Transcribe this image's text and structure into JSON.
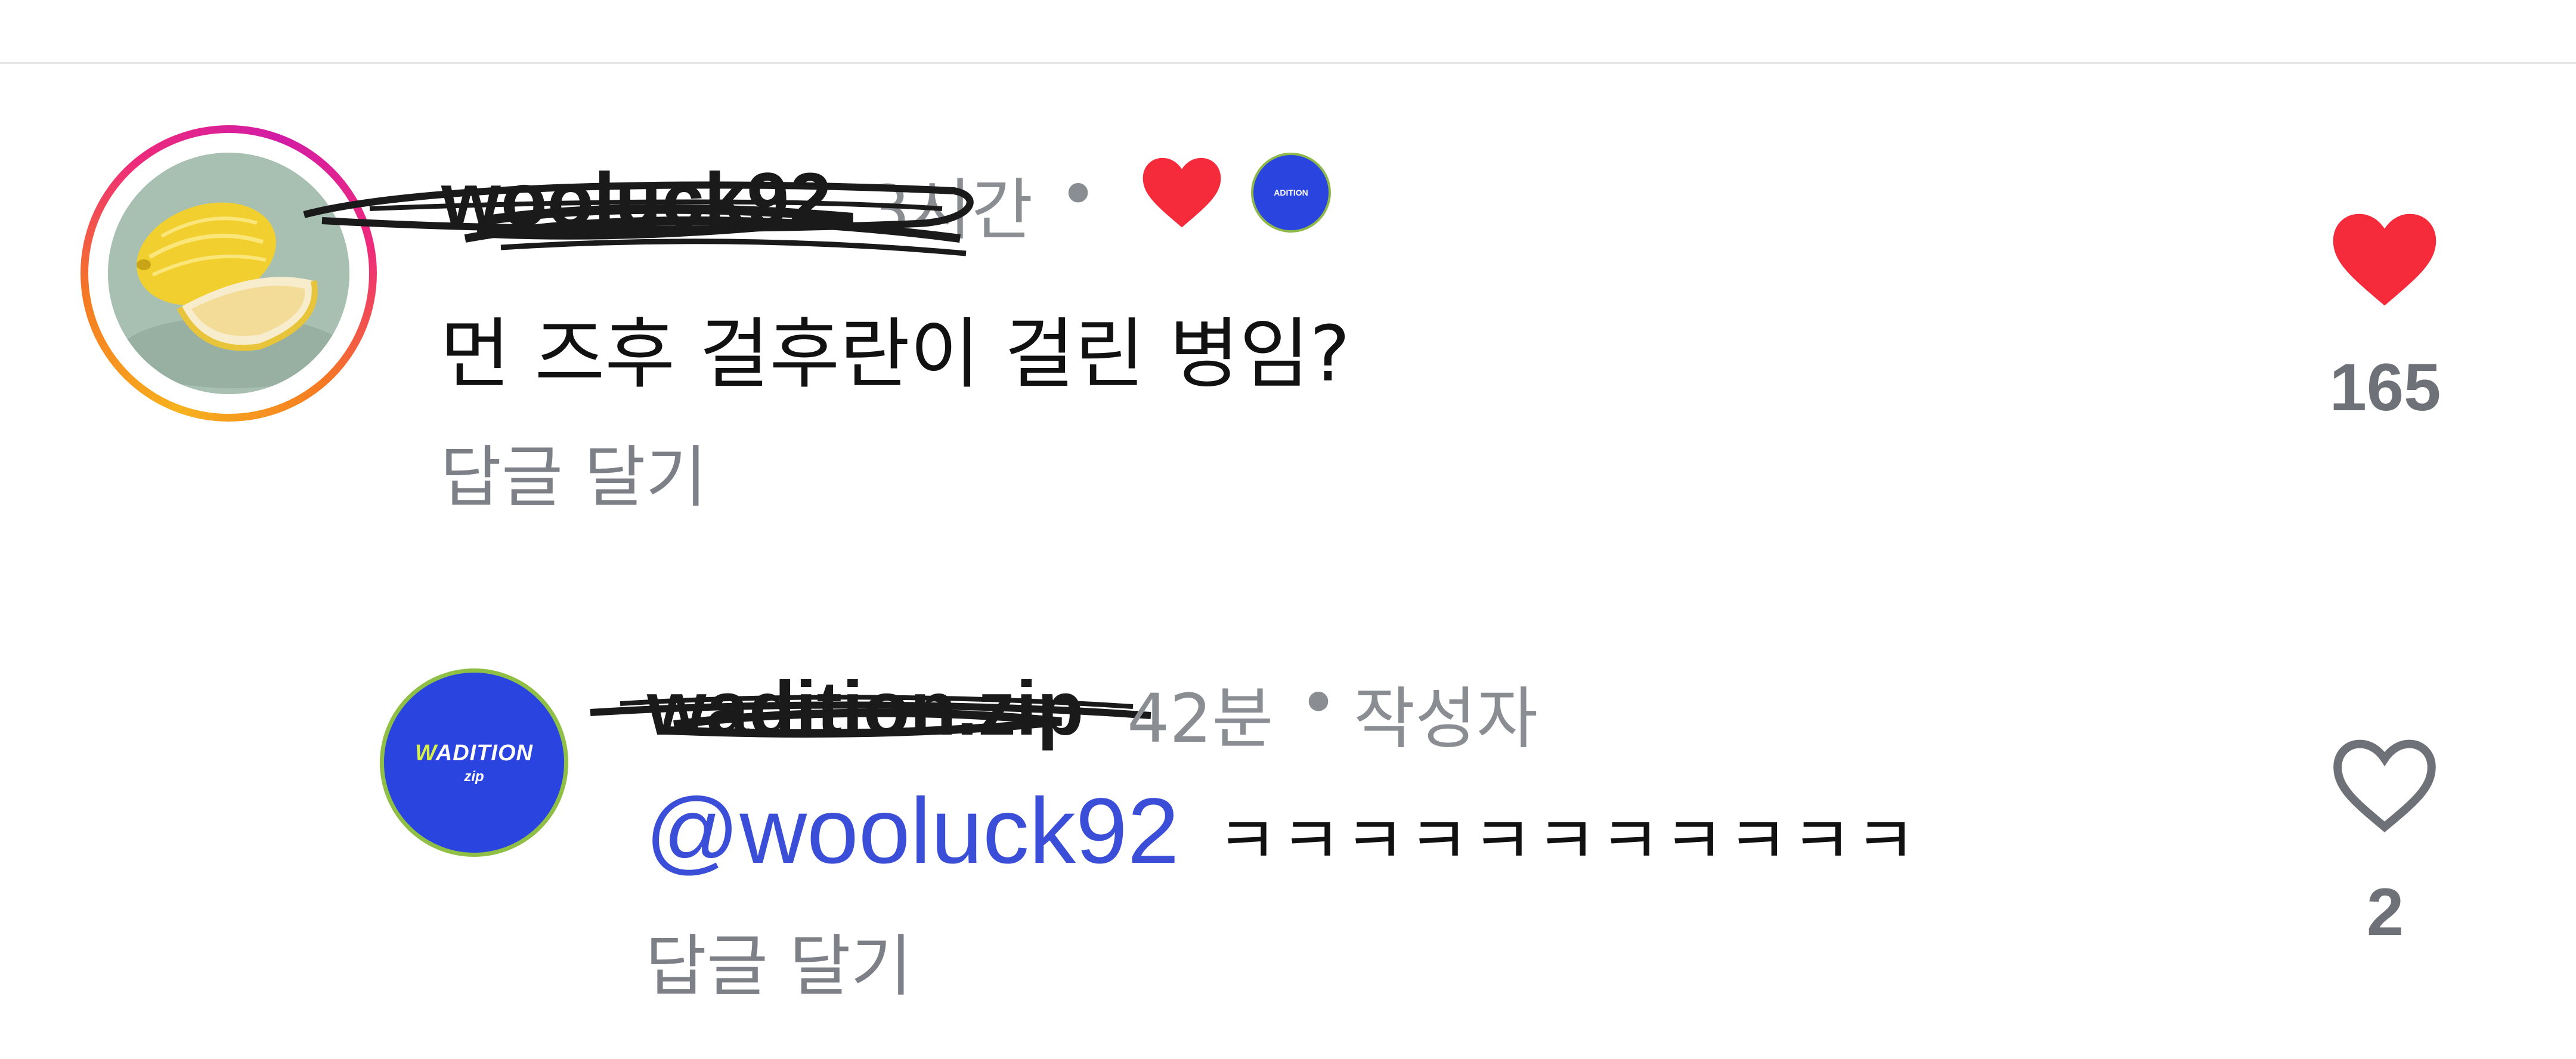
{
  "comments": [
    {
      "username": "wooluck92",
      "time": "3시간",
      "separator": "•",
      "text": "먼 즈후 걸후란이 걸린 병임?",
      "reply_label": "답글 달기",
      "like_count": "165",
      "liked": true,
      "creator_liked": true
    }
  ],
  "replies": [
    {
      "username": "wadition.zip",
      "time": "42분",
      "separator": "•",
      "author_badge": "작성자",
      "avatar_text": {
        "title_highlight": "W",
        "title_rest": "ADITION",
        "sub": "zip"
      },
      "mention": "@wooluck92",
      "text": "ㅋㅋㅋㅋㅋㅋㅋㅋㅋㅋㅋ",
      "reply_label": "답글 달기",
      "like_count": "2",
      "liked": false
    }
  ],
  "colors": {
    "heart_liked": "#f52b3b",
    "heart_outline": "#6e7177",
    "mention": "#3b4ed8",
    "brand_blue": "#2a44e0"
  },
  "icons": {
    "like_filled": "heart-filled-icon",
    "like_outline": "heart-outline-icon",
    "creator_like": "heart-filled-icon"
  }
}
